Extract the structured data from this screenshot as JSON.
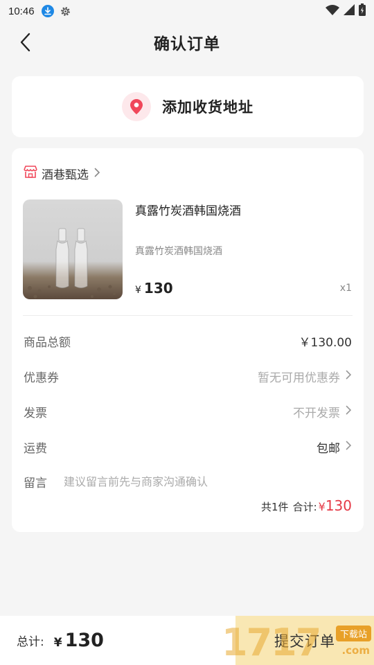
{
  "status_bar": {
    "time": "10:46",
    "icons": [
      "download-icon",
      "gear-icon",
      "wifi-icon",
      "signal-icon",
      "battery-icon"
    ]
  },
  "nav": {
    "title": "确认订单",
    "back_icon": "chevron-left-icon"
  },
  "address": {
    "label": "添加收货地址",
    "icon": "location-pin-icon"
  },
  "order": {
    "shop_name": "酒巷甄选",
    "product": {
      "name": "真露竹炭酒韩国烧酒",
      "subtitle": "真露竹炭酒韩国烧酒",
      "currency": "¥",
      "price": "130",
      "quantity": "x1"
    },
    "rows": [
      {
        "label": "商品总额",
        "value": "￥130.00"
      },
      {
        "label": "优惠券",
        "value": "暂无可用优惠券"
      },
      {
        "label": "发票",
        "value": "不开发票"
      },
      {
        "label": "运费",
        "value": "包邮"
      }
    ],
    "message": {
      "label": "留言",
      "placeholder": "建议留言前先与商家沟通确认"
    },
    "summary": {
      "count": "共1件",
      "total_label": "合计:",
      "currency": "¥",
      "total": "130"
    }
  },
  "bottom_bar": {
    "total_label": "总计:",
    "currency": "¥",
    "total": "130",
    "submit_label": "提交订单"
  },
  "watermark": {
    "digits": "1717",
    "badge": "下载站",
    "suffix": ".com"
  },
  "colors": {
    "accent_red": "#e53946",
    "pin_bg": "#fde8eb",
    "submit_bg": "#f9e7b3",
    "download_blue": "#1e88e5"
  }
}
